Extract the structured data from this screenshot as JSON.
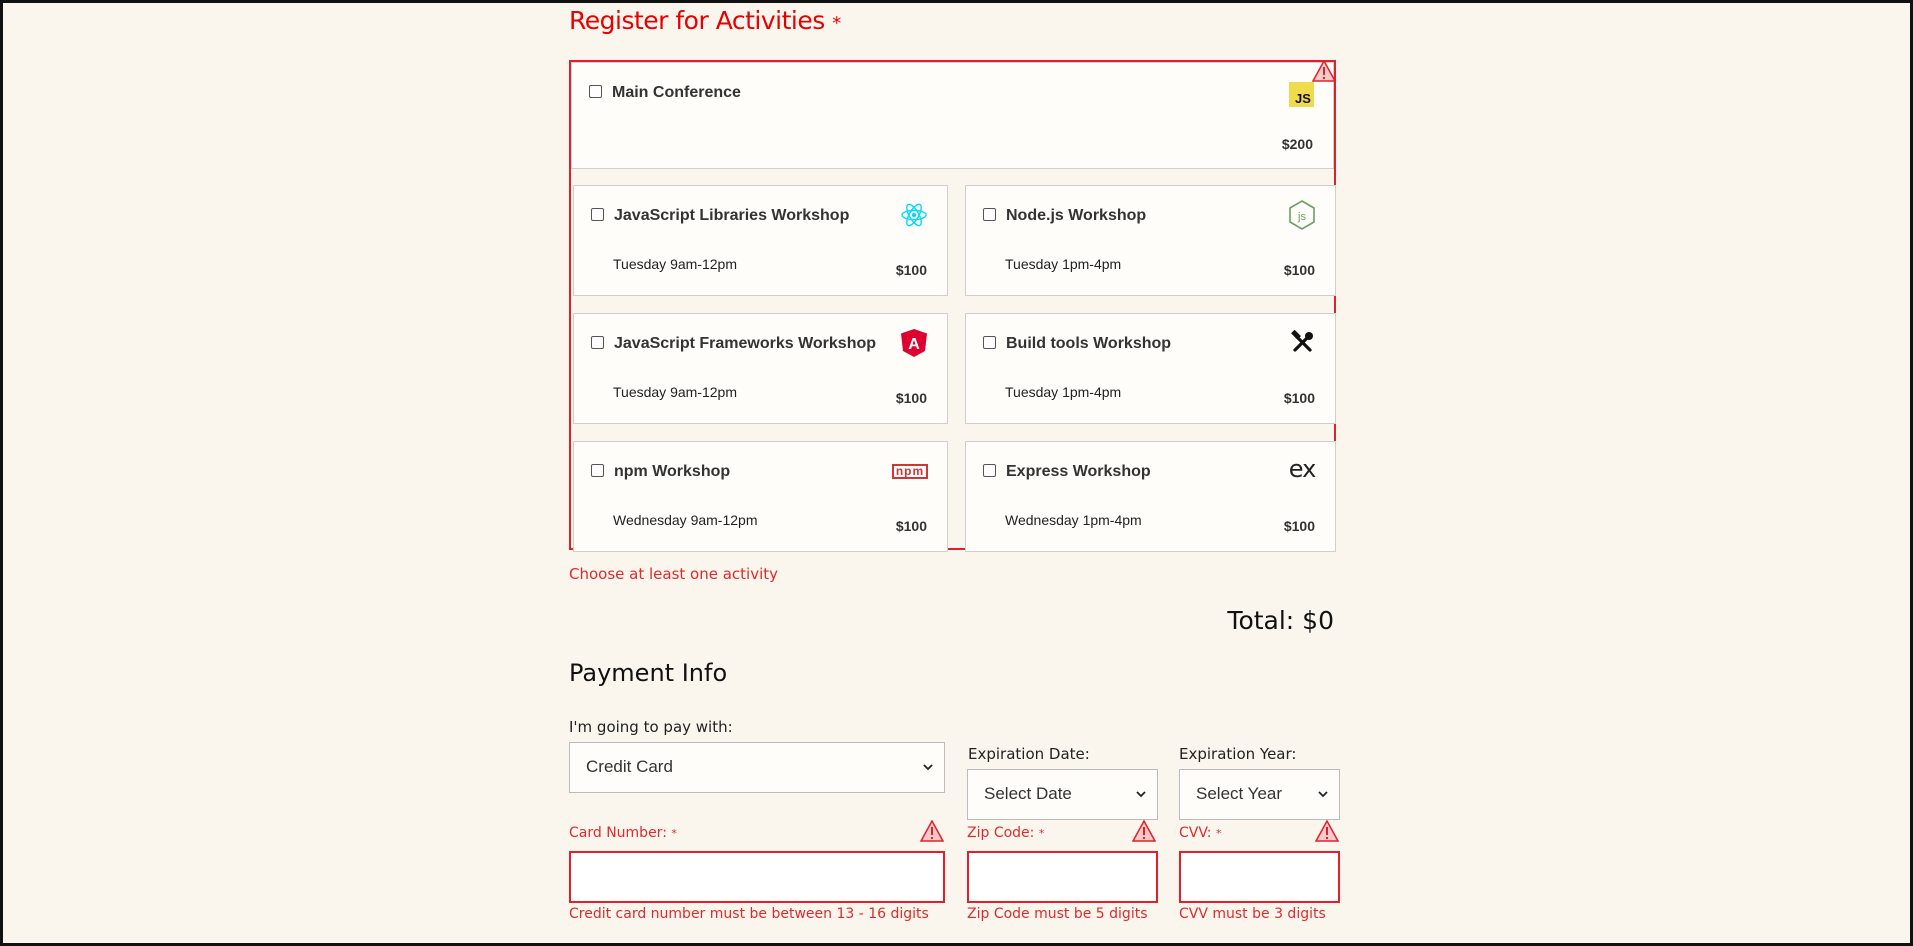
{
  "activities": {
    "title": "Register for Activities",
    "required_mark": "*",
    "error": "Choose at least one activity",
    "main": {
      "name": "Main Conference",
      "cost": "$200",
      "logo": "js-icon",
      "logo_text": "JS"
    },
    "workshops": [
      {
        "name": "JavaScript Libraries Workshop",
        "time": "Tuesday 9am-12pm",
        "cost": "$100",
        "logo": "react-icon"
      },
      {
        "name": "Node.js Workshop",
        "time": "Tuesday 1pm-4pm",
        "cost": "$100",
        "logo": "nodejs-icon"
      },
      {
        "name": "JavaScript Frameworks Workshop",
        "time": "Tuesday 9am-12pm",
        "cost": "$100",
        "logo": "angular-icon"
      },
      {
        "name": "Build tools Workshop",
        "time": "Tuesday 1pm-4pm",
        "cost": "$100",
        "logo": "tools-icon"
      },
      {
        "name": "npm Workshop",
        "time": "Wednesday 9am-12pm",
        "cost": "$100",
        "logo": "npm-icon",
        "logo_text": "npm"
      },
      {
        "name": "Express Workshop",
        "time": "Wednesday 1pm-4pm",
        "cost": "$100",
        "logo": "express-icon",
        "logo_text": "ex"
      }
    ]
  },
  "total": "Total: $0",
  "payment": {
    "title": "Payment Info",
    "method_label": "I'm going to pay with:",
    "method_value": "Credit Card",
    "exp_date_label": "Expiration Date:",
    "exp_date_value": "Select Date",
    "exp_year_label": "Expiration Year:",
    "exp_year_value": "Select Year",
    "card_label": "Card Number:",
    "zip_label": "Zip Code:",
    "cvv_label": "CVV:",
    "required_mark": "*",
    "card_error": "Credit card number must be between 13 - 16 digits",
    "zip_error": "Zip Code must be 5 digits",
    "cvv_error": "CVV must be 3 digits"
  },
  "colors": {
    "error": "#e02a2a",
    "background": "#faf6ee",
    "js_yellow": "#f0db4f",
    "react": "#00d8ff",
    "node": "#68a063",
    "angular": "#dd0031",
    "npm": "#cb3837"
  }
}
